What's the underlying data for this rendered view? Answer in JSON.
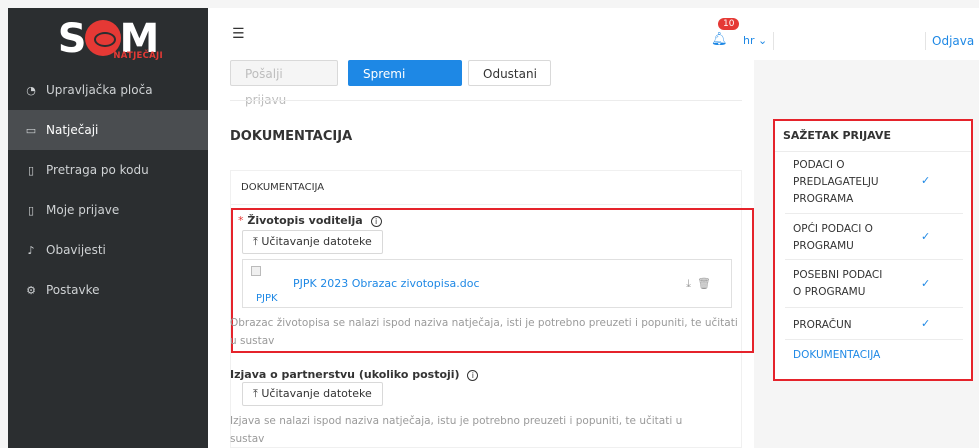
{
  "app": {
    "logo_text_left": "S",
    "logo_text_right": "M",
    "logo_subtitle": "NATJEČAJI"
  },
  "sidebar": {
    "items": [
      {
        "label": "Upravljačka ploča",
        "icon": "dashboard-icon",
        "active": false
      },
      {
        "label": "Natječaji",
        "icon": "folder-icon",
        "active": true
      },
      {
        "label": "Pretraga po kodu",
        "icon": "document-icon",
        "active": false
      },
      {
        "label": "Moje prijave",
        "icon": "document-edit-icon",
        "active": false
      },
      {
        "label": "Obavijesti",
        "icon": "bell-icon",
        "active": false
      },
      {
        "label": "Postavke",
        "icon": "gear-icon",
        "active": false
      }
    ]
  },
  "topbar": {
    "notification_count": "10",
    "language": "hr",
    "logout": "Odjava"
  },
  "toolbar": {
    "submit_label": "Pošalji prijavu",
    "save_label": "Spremi prijavu",
    "cancel_label": "Odustani"
  },
  "main": {
    "section_title": "DOKUMENTACIJA",
    "card_title": "DOKUMENTACIJA",
    "field1": {
      "required_mark": "*",
      "label": "Životopis voditelja",
      "upload_label": "Učitavanje datoteke",
      "file_thumb_label": "PJPK",
      "file_name": "PJPK 2023 Obrazac zivotopisa.doc",
      "hint": "Obrazac životopisa se nalazi ispod naziva natječaja, isti je potrebno preuzeti i popuniti, te učitati u sustav"
    },
    "field2": {
      "label": "Izjava o partnerstvu (ukoliko postoji)",
      "upload_label": "Učitavanje datoteke",
      "hint": "Izjava se nalazi ispod naziva natječaja, istu je potrebno preuzeti i popuniti, te učitati u sustav"
    }
  },
  "summary": {
    "title": "SAŽETAK PRIJAVE",
    "items": [
      {
        "label": "PODACI O PREDLAGATELJU PROGRAMA",
        "done": true
      },
      {
        "label": "OPĆI PODACI O PROGRAMU",
        "done": true
      },
      {
        "label": "POSEBNI PODACI O PROGRAMU",
        "done": true
      },
      {
        "label": "PRORAČUN",
        "done": true
      },
      {
        "label": "DOKUMENTACIJA",
        "done": false
      }
    ]
  },
  "colors": {
    "accent": "#1e88e5",
    "sidebar_bg": "#2b2e30",
    "highlight_red": "#e5232b"
  }
}
